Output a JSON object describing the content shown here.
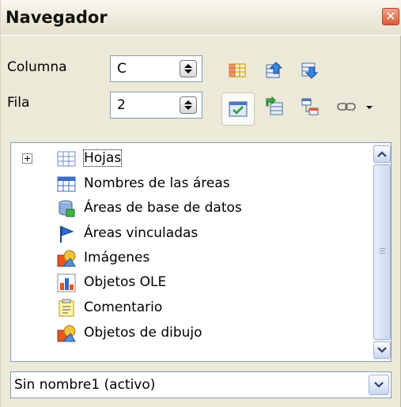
{
  "window": {
    "title": "Navegador",
    "close_glyph": "✕"
  },
  "fields": {
    "column": {
      "label": "Columna",
      "value": "C"
    },
    "row": {
      "label": "Fila",
      "value": "2"
    }
  },
  "toolbar": {
    "icons": [
      "data-range-icon",
      "start-icon",
      "end-icon",
      "toggle-content-icon",
      "scenarios-icon",
      "drag-mode-icon",
      "link-icon",
      "dropdown-arrow-icon"
    ]
  },
  "tree": {
    "items": [
      {
        "label": "Hojas",
        "icon": "sheet-icon",
        "expandable": true
      },
      {
        "label": "Nombres de las áreas",
        "icon": "range-names-icon"
      },
      {
        "label": "Áreas de base de datos",
        "icon": "database-icon"
      },
      {
        "label": "Áreas vinculadas",
        "icon": "flag-icon"
      },
      {
        "label": "Imágenes",
        "icon": "image-icon"
      },
      {
        "label": "Objetos OLE",
        "icon": "ole-chart-icon"
      },
      {
        "label": "Comentario",
        "icon": "comment-icon"
      },
      {
        "label": "Objetos de dibujo",
        "icon": "drawing-icon"
      }
    ]
  },
  "document_select": {
    "value": "Sin nombre1 (activo)"
  },
  "colors": {
    "window_bg": "#ece9d8",
    "border": "#7f9db9",
    "close_red": "#df5a36"
  }
}
